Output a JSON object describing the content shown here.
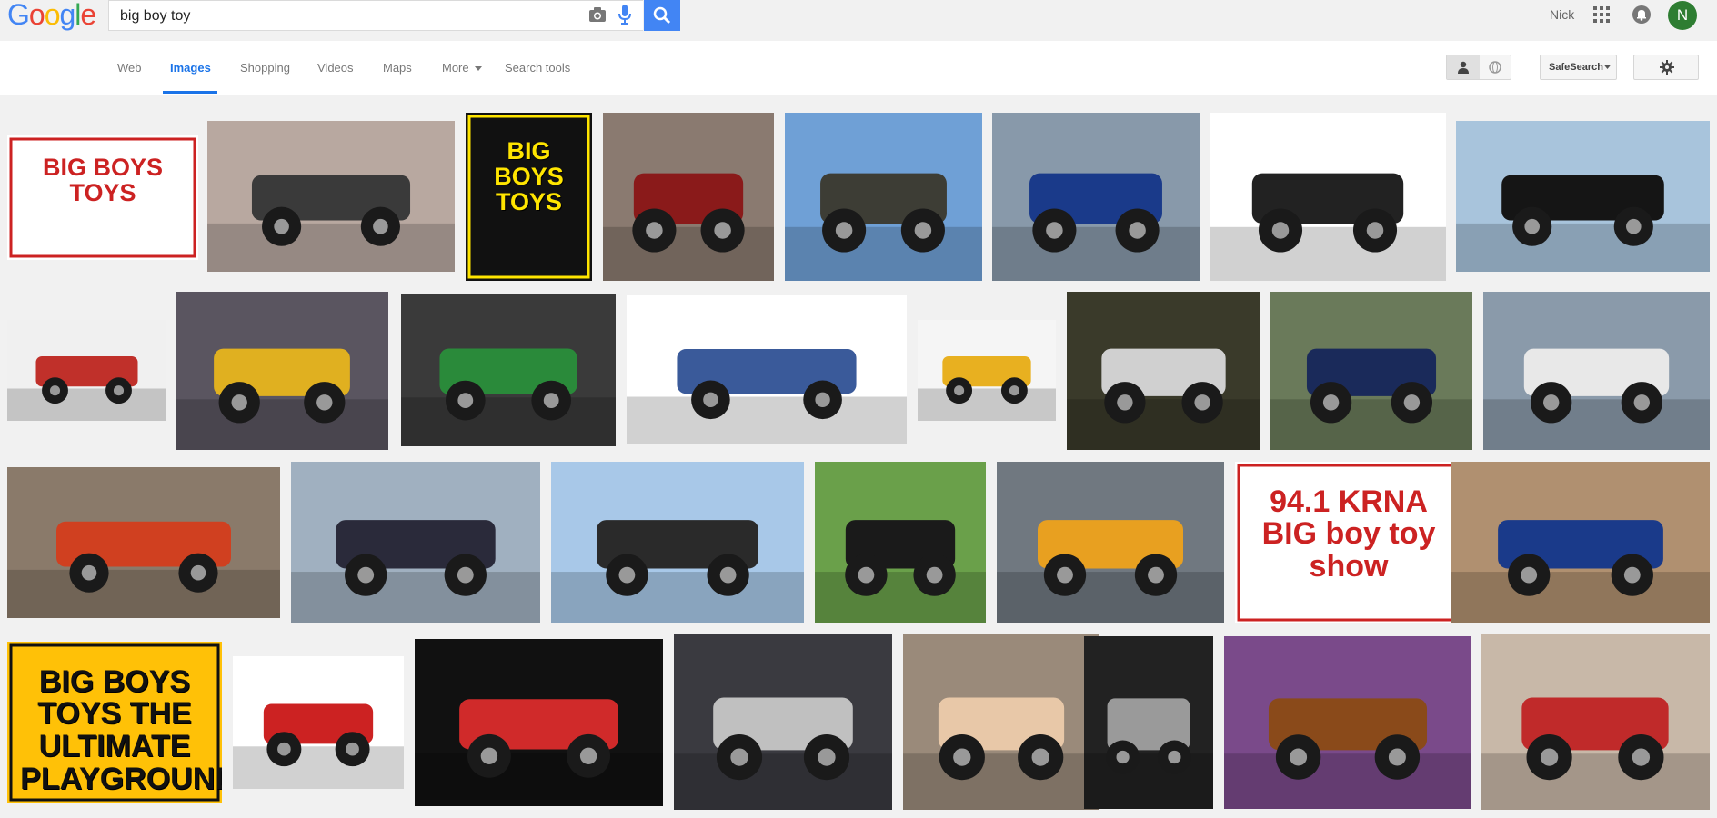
{
  "header": {
    "logo": [
      "G",
      "o",
      "o",
      "g",
      "l",
      "e"
    ],
    "logo_colors": [
      "#4285f4",
      "#ea4335",
      "#fbbc05",
      "#4285f4",
      "#34a853",
      "#ea4335"
    ],
    "query": "big boy toy",
    "user_name": "Nick",
    "avatar_letter": "N"
  },
  "nav": {
    "tabs": [
      "Web",
      "Images",
      "Shopping",
      "Videos",
      "Maps",
      "More",
      "Search tools"
    ],
    "active_tab": "Images",
    "safesearch_label": "SafeSearch"
  },
  "colors": {
    "accent": "#1a73e8",
    "search_button": "#4285f4",
    "avatar_bg": "#2e7d32"
  },
  "results": [
    {
      "label": "BIG BOYS TOYS",
      "kind": "logo",
      "bg": "#ffffff",
      "fg": "#cc2222"
    },
    {
      "kind": "photo",
      "bg": "#b8a8a0",
      "fg": "#3a3a3a"
    },
    {
      "label": "BIG BOYS TOYS",
      "kind": "poster",
      "bg": "#111111",
      "fg": "#ffe500"
    },
    {
      "kind": "photo",
      "bg": "#8a7a70",
      "fg": "#8a1a1a"
    },
    {
      "kind": "photo",
      "bg": "#6fa0d6",
      "fg": "#3d3d35"
    },
    {
      "kind": "photo",
      "bg": "#8899aa",
      "fg": "#1a3a8a"
    },
    {
      "kind": "photo",
      "bg": "#ffffff",
      "fg": "#222222"
    },
    {
      "kind": "photo",
      "bg": "#a8c4dc",
      "fg": "#151515"
    },
    {
      "kind": "photo",
      "bg": "#f0f0f0",
      "fg": "#c0302a"
    },
    {
      "kind": "photo",
      "bg": "#5a5560",
      "fg": "#e0b020"
    },
    {
      "kind": "photo",
      "bg": "#3a3a3a",
      "fg": "#2a8a3a"
    },
    {
      "kind": "photo",
      "bg": "#ffffff",
      "fg": "#3a5a9a"
    },
    {
      "kind": "photo",
      "bg": "#f5f5f5",
      "fg": "#e8b020"
    },
    {
      "kind": "photo",
      "bg": "#3a3a2a",
      "fg": "#d0d0d0"
    },
    {
      "kind": "photo",
      "bg": "#6a7a5a",
      "fg": "#1a2a5a"
    },
    {
      "kind": "photo",
      "bg": "#8a9aaa",
      "fg": "#e8e8e8"
    },
    {
      "kind": "photo",
      "bg": "#8a7a6a",
      "fg": "#d04020"
    },
    {
      "kind": "photo",
      "bg": "#a0b0c0",
      "fg": "#2a2a3a"
    },
    {
      "kind": "photo",
      "bg": "#a8c8e8",
      "fg": "#2a2a2a"
    },
    {
      "kind": "photo",
      "bg": "#6aa04a",
      "fg": "#1a1a1a"
    },
    {
      "kind": "photo",
      "bg": "#707880",
      "fg": "#e8a020"
    },
    {
      "label": "94.1 KRNA BIG boy toy show",
      "kind": "logo",
      "bg": "#ffffff",
      "fg": "#cc2222"
    },
    {
      "kind": "photo",
      "bg": "#b09070",
      "fg": "#1a3a8a"
    },
    {
      "label": "BIG BOYS TOYS THE ULTIMATE PLAYGROUND™",
      "kind": "poster",
      "bg": "#ffc107",
      "fg": "#111111"
    },
    {
      "kind": "photo",
      "bg": "#ffffff",
      "fg": "#cc2222"
    },
    {
      "kind": "photo",
      "bg": "#111111",
      "fg": "#d02a2a"
    },
    {
      "kind": "photo",
      "bg": "#3a3a40",
      "fg": "#c0c0c0"
    },
    {
      "kind": "photo",
      "bg": "#9a8a7a",
      "fg": "#e8c8a8"
    },
    {
      "kind": "photo",
      "bg": "#222222",
      "fg": "#9a9a9a"
    },
    {
      "kind": "photo",
      "bg": "#7a4a8a",
      "fg": "#8a4a1a"
    },
    {
      "kind": "photo",
      "bg": "#c8b8a8",
      "fg": "#c02a2a"
    }
  ]
}
